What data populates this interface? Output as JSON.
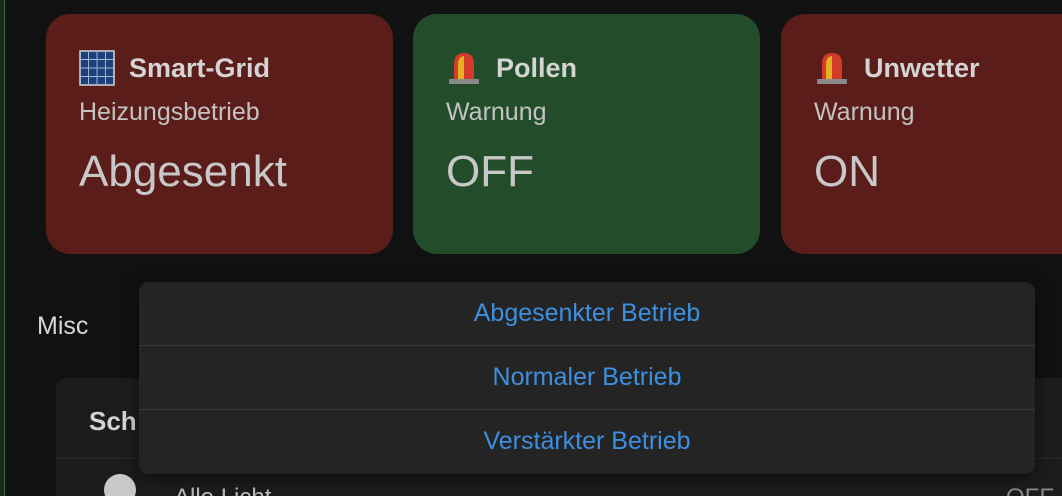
{
  "cards": [
    {
      "title": "Smart-Grid",
      "subtitle": "Heizungsbetrieb",
      "value": "Abgesenkt",
      "icon": "solar-panel-icon",
      "color": "#5a1d1a"
    },
    {
      "title": "Pollen",
      "subtitle": "Warnung",
      "value": "OFF",
      "icon": "siren-icon",
      "color": "#234d2a"
    },
    {
      "title": "Unwetter",
      "subtitle": "Warnung",
      "value": "ON",
      "icon": "siren-icon",
      "color": "#5a1d1a"
    }
  ],
  "section": {
    "label": "Misc",
    "header": "Sch",
    "row_label": "Alle Licht",
    "row_state": "OFF"
  },
  "menu": {
    "items": [
      "Abgesenkter Betrieb",
      "Normaler Betrieb",
      "Verstärkter Betrieb"
    ],
    "accent": "#3d8fe0"
  }
}
